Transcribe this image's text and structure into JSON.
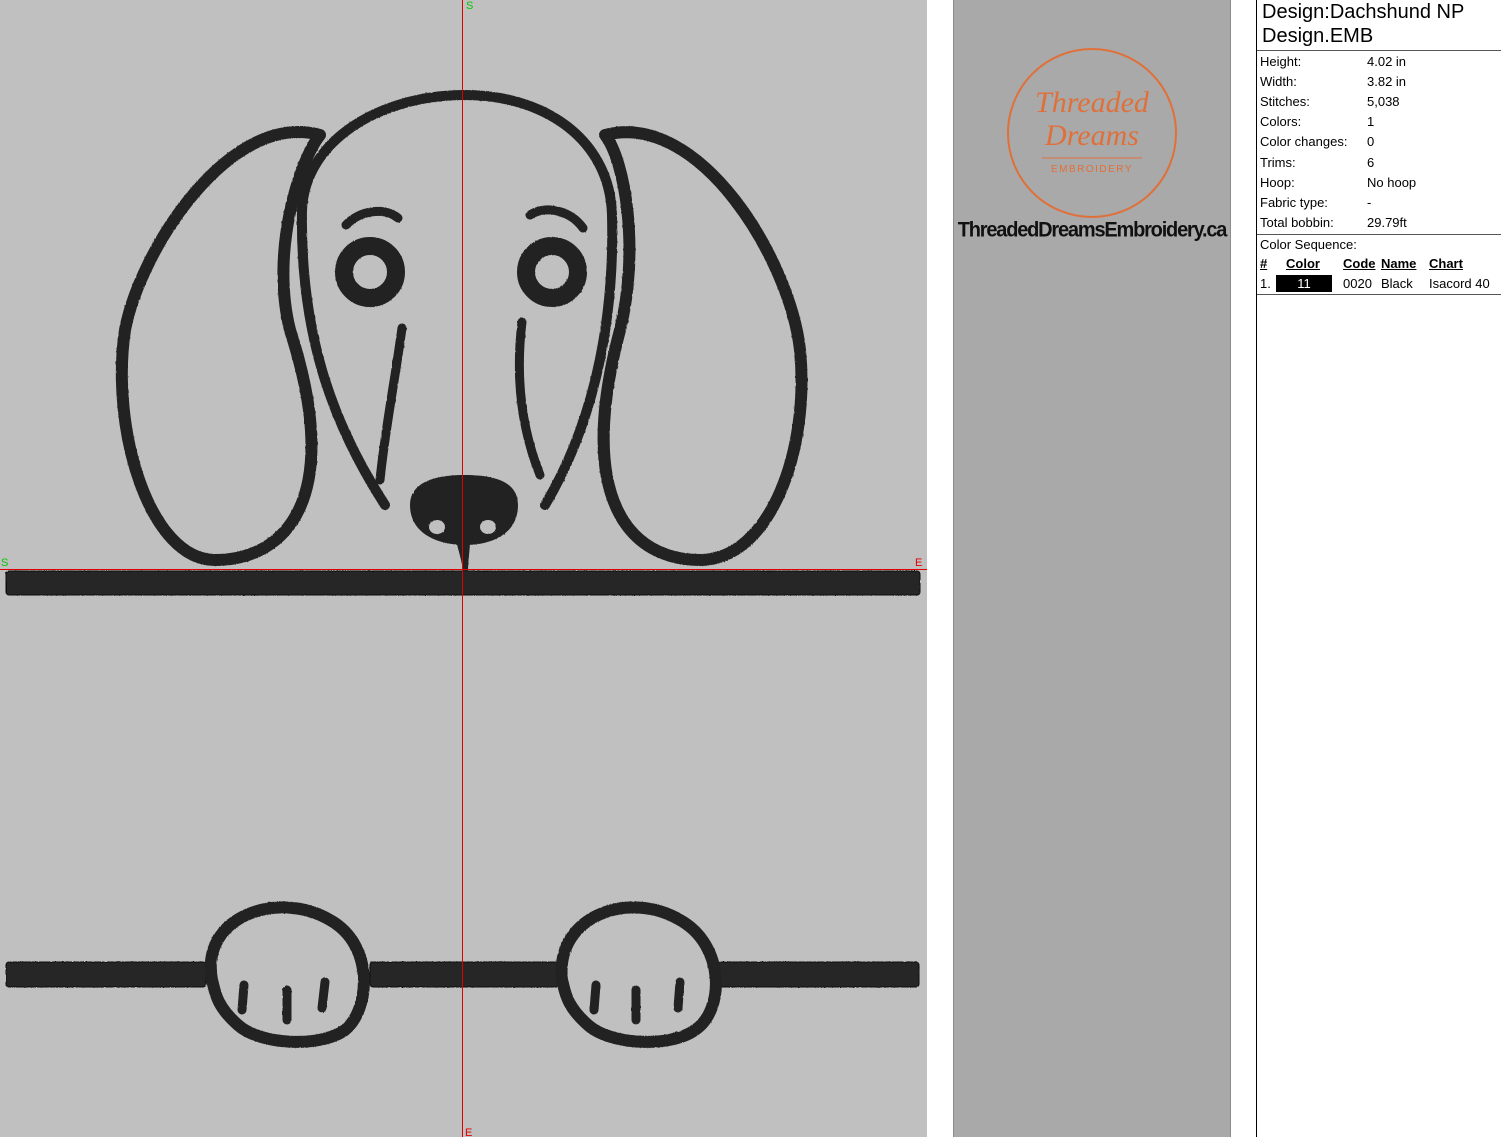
{
  "canvas": {
    "background": "#c0c0c0",
    "thread_color": "#222222",
    "guide_color": "#e00000",
    "marker_color": "#00c800",
    "markers": {
      "top": "S",
      "bottom": "E",
      "left": "S",
      "right": "E"
    }
  },
  "logo": {
    "brand_line1": "Threaded",
    "brand_line2": "Dreams",
    "tagline": "EMBROIDERY",
    "accent_color": "#e0703a",
    "website": "ThreadedDreamsEmbroidery.ca"
  },
  "info": {
    "title_line1": "Design:Dachshund NP",
    "title_line2": "Design.EMB",
    "stats": [
      {
        "label": "Height:",
        "value": "4.02 in"
      },
      {
        "label": "Width:",
        "value": "3.82 in"
      },
      {
        "label": "Stitches:",
        "value": "5,038"
      },
      {
        "label": "Colors:",
        "value": "1"
      },
      {
        "label": "Color changes:",
        "value": "0"
      },
      {
        "label": "Trims:",
        "value": "6"
      },
      {
        "label": "Hoop:",
        "value": "No hoop"
      },
      {
        "label": "Fabric type:",
        "value": "-"
      },
      {
        "label": "Total bobbin:",
        "value": "29.79ft"
      }
    ],
    "sequence_title": "Color Sequence:",
    "sequence_headers": {
      "num": "#",
      "color": "Color",
      "code": "Code",
      "name": "Name",
      "chart": "Chart"
    },
    "sequence": [
      {
        "num": "1.",
        "color_number": "11",
        "swatch": "#000000",
        "code": "0020",
        "name": "Black",
        "chart": "Isacord 40"
      }
    ]
  }
}
